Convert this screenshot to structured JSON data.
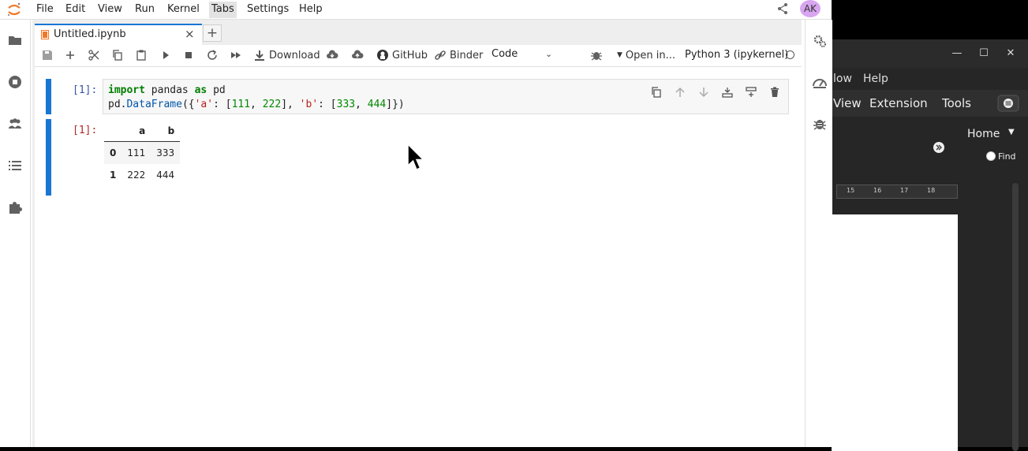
{
  "menubar": {
    "items": [
      "File",
      "Edit",
      "View",
      "Run",
      "Kernel",
      "Tabs",
      "Settings",
      "Help"
    ],
    "active": "Tabs"
  },
  "user": {
    "initials": "AK",
    "avatar_color": "#d8a5f0"
  },
  "tab": {
    "label": "Untitled.ipynb",
    "close": "×"
  },
  "new_tab": "+",
  "toolbar": {
    "download": "Download",
    "github": "GitHub",
    "binder": "Binder",
    "cell_type": "Code",
    "open_in": "Open in...",
    "kernel": "Python 3 (ipykernel)"
  },
  "cells": {
    "input_prompt": "[1]:",
    "output_prompt": "[1]:",
    "code_line1": {
      "kw1": "import",
      "mod": " pandas ",
      "kw2": "as",
      "alias": " pd"
    },
    "code_line2": "pd.DataFrame({'a': [111, 222], 'b': [333, 444]})"
  },
  "dataframe": {
    "columns": [
      "a",
      "b"
    ],
    "rows": [
      {
        "index": "0",
        "a": "111",
        "b": "333"
      },
      {
        "index": "1",
        "a": "222",
        "b": "444"
      }
    ]
  },
  "background_app": {
    "menu": [
      "low",
      "Help"
    ],
    "tabs": [
      "View",
      "Extension",
      "Tools"
    ],
    "home": "Home",
    "find": "Find",
    "ruler": [
      "15",
      "16",
      "17",
      "18"
    ]
  },
  "colors": {
    "accent": "#1976d2",
    "orange": "#f37726"
  }
}
